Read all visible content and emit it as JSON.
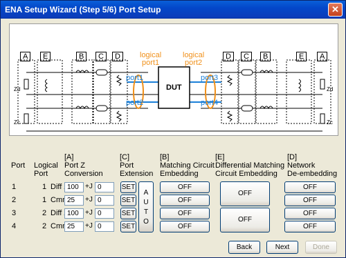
{
  "window": {
    "title": "ENA Setup Wizard (Step 5/6) Port Setup",
    "close_glyph": "✕"
  },
  "diagram": {
    "blocks_left": [
      "A",
      "E",
      "B",
      "C",
      "D"
    ],
    "blocks_right": [
      "D",
      "C",
      "B",
      "E",
      "A"
    ],
    "logical_port1": [
      "logical",
      "port1"
    ],
    "logical_port2": [
      "logical",
      "port2"
    ],
    "port_labels": [
      "port1",
      "port2",
      "port3",
      "port4"
    ],
    "dut": "DUT",
    "z_left": [
      "Zd",
      "Zc"
    ],
    "z_right": [
      "Zd",
      "Zc"
    ]
  },
  "headers": {
    "port": "Port",
    "logical_port": [
      "Logical",
      "Port"
    ],
    "port_z": [
      "[A]",
      "Port Z",
      "Conversion"
    ],
    "port_ext": [
      "[C]",
      "Port",
      "Extension"
    ],
    "matching": [
      "[B]",
      "Matching Circuit",
      "Embedding"
    ],
    "diff_matching": [
      "[E]",
      "Differential Matching",
      "Circuit Embedding"
    ],
    "network": [
      "[D]",
      "Network",
      "De-embedding"
    ]
  },
  "rows": [
    {
      "port": "1",
      "logical": "1",
      "type": "Diff Z",
      "real": "100",
      "imag": "0"
    },
    {
      "port": "2",
      "logical": "1",
      "type": "Cmn Z",
      "real": "25",
      "imag": "0"
    },
    {
      "port": "3",
      "logical": "2",
      "type": "Diff Z",
      "real": "100",
      "imag": "0"
    },
    {
      "port": "4",
      "logical": "2",
      "type": "Cmn Z",
      "real": "25",
      "imag": "0"
    }
  ],
  "plus_j": "+J",
  "set_label": "SET",
  "auto_letters": [
    "A",
    "U",
    "T",
    "O"
  ],
  "off_label": "OFF",
  "footer": {
    "back": "Back",
    "next": "Next",
    "done": "Done"
  },
  "colors": {
    "accent_blue": "#1a7fd8",
    "accent_orange": "#f0901a",
    "title_bar": "#0347c9"
  }
}
